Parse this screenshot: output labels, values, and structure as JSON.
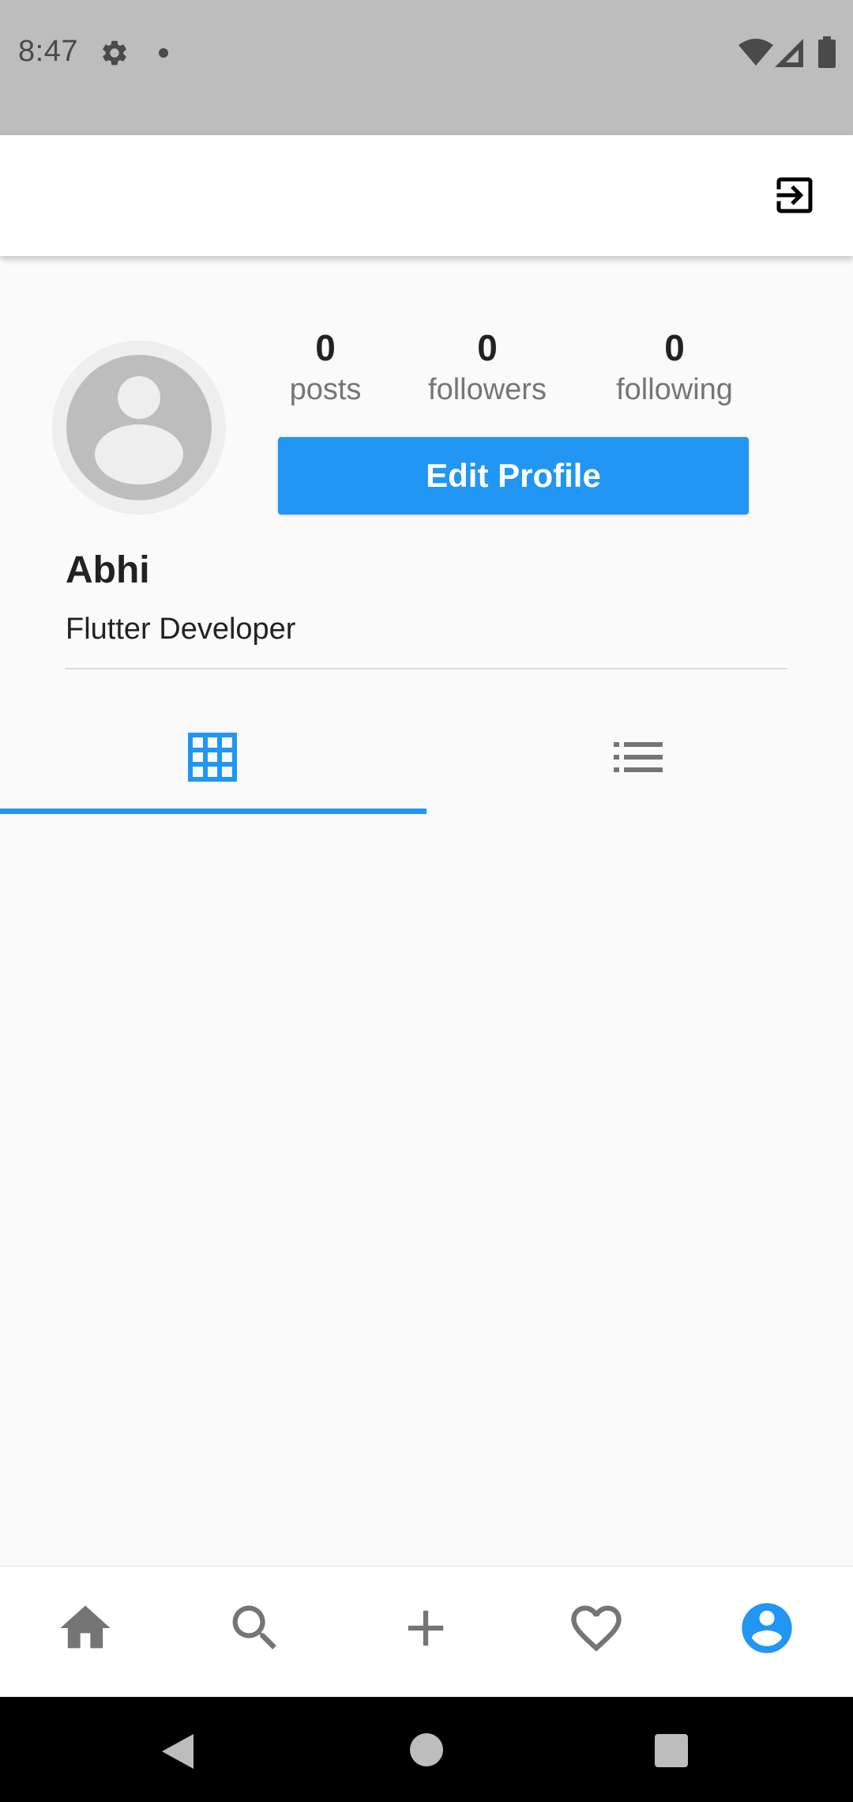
{
  "status_bar": {
    "time": "8:47"
  },
  "app_bar": {
    "action_icon": "exit-to-app-icon"
  },
  "profile": {
    "name": "Abhi",
    "bio": "Flutter Developer",
    "stats": {
      "posts": {
        "count": "0",
        "label": "posts"
      },
      "followers": {
        "count": "0",
        "label": "followers"
      },
      "following": {
        "count": "0",
        "label": "following"
      }
    },
    "edit_button_label": "Edit Profile"
  },
  "tabs": [
    {
      "icon": "grid-icon",
      "selected": true
    },
    {
      "icon": "list-icon",
      "selected": false
    }
  ],
  "bottom_nav": [
    {
      "icon": "home-icon",
      "active": false
    },
    {
      "icon": "search-icon",
      "active": false
    },
    {
      "icon": "add-icon",
      "active": false
    },
    {
      "icon": "heart-icon",
      "active": false
    },
    {
      "icon": "account-circle-icon",
      "active": true
    }
  ],
  "colors": {
    "accent": "#2196f3",
    "inactive_icon": "#757575",
    "status_bar": "#bdbdbd",
    "background": "#fafafa"
  }
}
